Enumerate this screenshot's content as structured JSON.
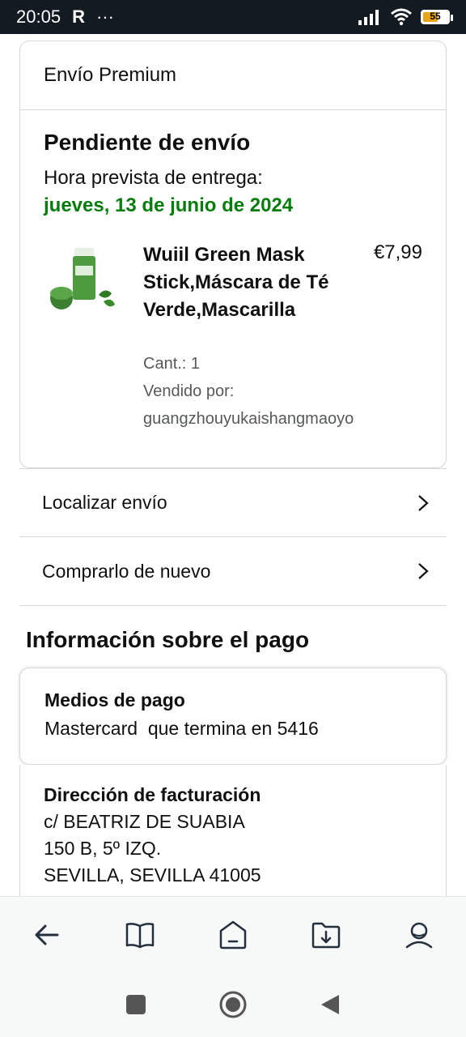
{
  "status_bar": {
    "time": "20:05",
    "indicator": "R",
    "dots": "···",
    "battery": "55"
  },
  "shipment": {
    "header": "Envío Premium",
    "status": "Pendiente de envío",
    "eta_label": "Hora prevista de entrega:",
    "eta_date": "jueves, 13 de junio de 2024",
    "item": {
      "title": "Wuiil Green Mask Stick,Máscara de Té Verde,Mascarilla",
      "price": "€7,99",
      "qty": "Cant.: 1",
      "seller_label": "Vendido por:",
      "seller": "guangzhouyukaishangmaoyo"
    }
  },
  "actions": {
    "track": "Localizar envío",
    "buy_again": "Comprarlo de nuevo"
  },
  "payment": {
    "section_title": "Información sobre el pago",
    "method_label": "Medios de pago",
    "method_value": "Mastercard  que termina en 5416"
  },
  "billing": {
    "label": "Dirección de facturación",
    "line1": "c/ BEATRIZ DE SUABIA",
    "line2": "150 B, 5º IZQ.",
    "line3": "SEVILLA, SEVILLA 41005"
  },
  "colors": {
    "accent_green": "#067d0c",
    "status_bar_bg": "#131a22",
    "battery_fill": "#e8a317"
  },
  "icons": {
    "bottom_nav": [
      "back-arrow-icon",
      "book-icon",
      "home-icon",
      "download-folder-icon",
      "account-icon"
    ],
    "system_nav": [
      "recent-apps-icon",
      "home-circle-icon",
      "back-triangle-icon"
    ]
  }
}
